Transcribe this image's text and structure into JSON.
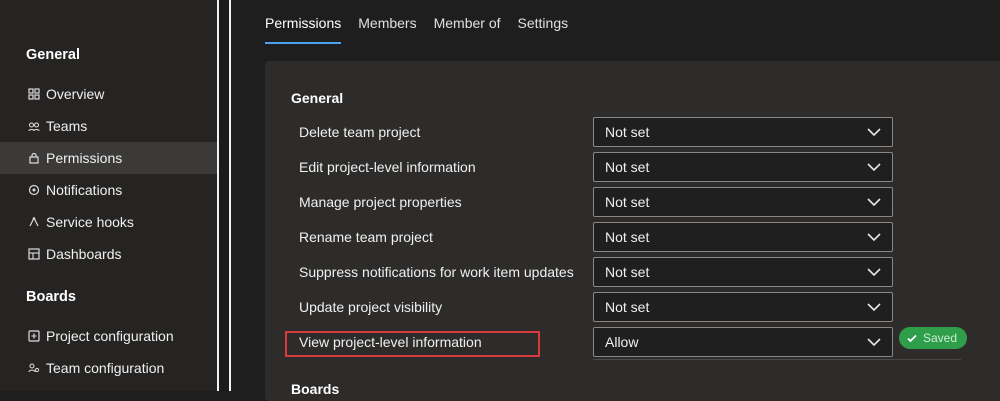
{
  "sidebar": {
    "sections": [
      {
        "title": "General"
      },
      {
        "title": "Boards"
      }
    ],
    "items": [
      {
        "label": "Overview",
        "icon": "overview-icon"
      },
      {
        "label": "Teams",
        "icon": "teams-icon"
      },
      {
        "label": "Permissions",
        "icon": "lock-icon",
        "active": true
      },
      {
        "label": "Notifications",
        "icon": "notifications-icon"
      },
      {
        "label": "Service hooks",
        "icon": "service-hooks-icon"
      },
      {
        "label": "Dashboards",
        "icon": "dashboards-icon"
      },
      {
        "label": "Project configuration",
        "icon": "project-configuration-icon"
      },
      {
        "label": "Team configuration",
        "icon": "team-configuration-icon"
      }
    ]
  },
  "tabs": [
    {
      "label": "Permissions",
      "active": true
    },
    {
      "label": "Members"
    },
    {
      "label": "Member of"
    },
    {
      "label": "Settings"
    }
  ],
  "permissions": {
    "general_title": "General",
    "boards_title": "Boards",
    "rows": [
      {
        "label": "Delete team project",
        "value": "Not set"
      },
      {
        "label": "Edit project-level information",
        "value": "Not set"
      },
      {
        "label": "Manage project properties",
        "value": "Not set"
      },
      {
        "label": "Rename team project",
        "value": "Not set"
      },
      {
        "label": "Suppress notifications for work item updates",
        "value": "Not set"
      },
      {
        "label": "Update project visibility",
        "value": "Not set"
      },
      {
        "label": "View project-level information",
        "value": "Allow"
      }
    ],
    "saved_label": "Saved"
  },
  "colors": {
    "accent": "#4aa3f0",
    "highlight": "#d83b3b",
    "saved_badge": "#2e9e4a"
  }
}
